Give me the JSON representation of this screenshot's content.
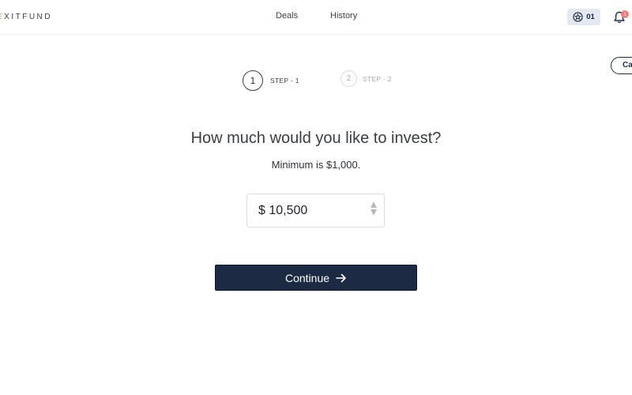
{
  "header": {
    "logo_prefix": "E",
    "logo_rest": "XITFUND",
    "nav": {
      "deals": "Deals",
      "history": "History"
    },
    "badge_count": "01",
    "notification_count": "1"
  },
  "cancel_label": "Ca",
  "steps": [
    {
      "number": "1",
      "label": "STEP - 1"
    },
    {
      "number": "2",
      "label": "STEP - 2"
    }
  ],
  "question": "How much would you like to invest?",
  "minimum_text": "Minimum is $1,000.",
  "amount": {
    "value": "$ 10,500"
  },
  "continue_label": "Continue",
  "colors": {
    "primary": "#1c2a44",
    "accent": "#8fb04a",
    "notification": "#f07a78"
  },
  "icons": [
    "star-badge-icon",
    "bell-icon",
    "arrow-right-icon",
    "spinner-up-icon",
    "spinner-down-icon"
  ]
}
